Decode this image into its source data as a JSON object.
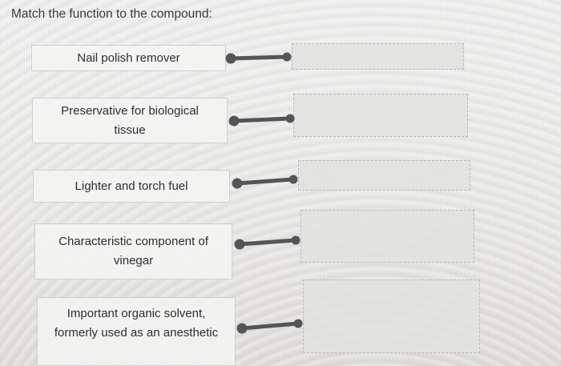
{
  "prompt": "Match the function to the compound:",
  "items": [
    {
      "label": "Nail polish remover"
    },
    {
      "label": "Preservative for biological tissue"
    },
    {
      "label": "Lighter and torch fuel"
    },
    {
      "label": "Characteristic component of vinegar"
    },
    {
      "label": "Important organic solvent, formerly used as an anesthetic"
    }
  ],
  "colors": {
    "connector": "#555555",
    "text": "#2e2e2e"
  }
}
